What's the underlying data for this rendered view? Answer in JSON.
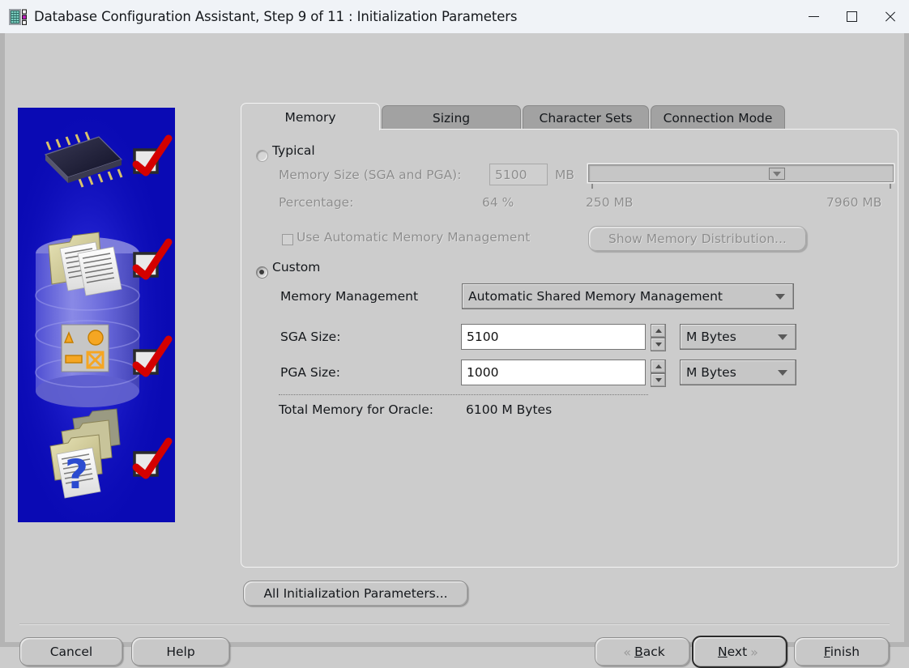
{
  "window": {
    "title": "Database Configuration Assistant, Step 9 of 11 : Initialization Parameters",
    "icon": "database-icon",
    "controls": {
      "minimize": "minimize-icon",
      "maximize": "maximize-icon",
      "close": "close-icon"
    }
  },
  "tabs": [
    {
      "label": "Memory",
      "active": true
    },
    {
      "label": "Sizing",
      "active": false
    },
    {
      "label": "Character Sets",
      "active": false
    },
    {
      "label": "Connection Mode",
      "active": false
    }
  ],
  "memory_tab": {
    "typical": {
      "radio_label": "Typical",
      "selected": false,
      "enabled": false,
      "memory_size_label": "Memory Size (SGA and PGA):",
      "memory_size_value": "5100",
      "memory_size_unit": "MB",
      "percentage_label": "Percentage:",
      "percentage_value": "64 %",
      "slider_min_label": "250 MB",
      "slider_max_label": "7960 MB",
      "slider_min": 250,
      "slider_max": 7960,
      "slider_value": 5100,
      "amm_checkbox_label": "Use Automatic Memory Management",
      "amm_checked": false,
      "show_distribution_button": "Show Memory Distribution..."
    },
    "custom": {
      "radio_label": "Custom",
      "selected": true,
      "enabled": true,
      "memory_management_label": "Memory Management",
      "memory_management_value": "Automatic Shared Memory Management",
      "sga_size_label": "SGA Size:",
      "sga_size_value": "5100",
      "sga_size_unit": "M Bytes",
      "pga_size_label": "PGA Size:",
      "pga_size_value": "1000",
      "pga_size_unit": "M Bytes",
      "total_memory_label": "Total Memory for Oracle:",
      "total_memory_value": "6100 M Bytes"
    }
  },
  "all_parameters_button": "All Initialization Parameters...",
  "footer": {
    "cancel": "Cancel",
    "help": "Help",
    "back": "Back",
    "back_mnemonic": "B",
    "next": "Next",
    "next_mnemonic": "N",
    "finish": "Finish",
    "finish_mnemonic": "F",
    "back_chevron": "«",
    "next_chevron": "»"
  },
  "colors": {
    "panel": "#cccccc",
    "titlebar": "#f0f3f7",
    "tab_inactive": "#a2a2a2",
    "banner_blue": "#0a0ab4",
    "check_red": "#d40000"
  }
}
